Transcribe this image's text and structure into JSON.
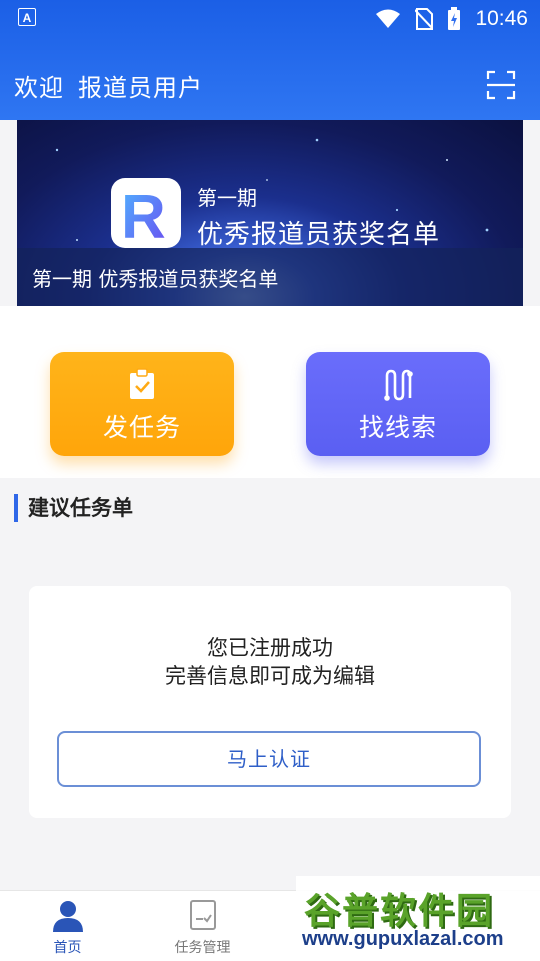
{
  "status_bar": {
    "app_icon_letter": "A",
    "time": "10:46"
  },
  "app_bar": {
    "greeting": "欢迎",
    "user_name": "报道员用户"
  },
  "banner": {
    "logo_letter": "R",
    "issue_label": "第一期",
    "headline": "优秀报道员获奖名单",
    "caption": "第一期 优秀报道员获奖名单"
  },
  "actions": {
    "post_task": "发任务",
    "find_clue": "找线索"
  },
  "section": {
    "title": "建议任务单"
  },
  "notice_card": {
    "line1": "您已注册成功",
    "line2": "完善信息即可成为编辑",
    "button": "马上认证"
  },
  "tab_bar": {
    "tabs": [
      {
        "label": "首页",
        "icon": "home-user-icon",
        "active": true
      },
      {
        "label": "任务管理",
        "icon": "task-list-icon",
        "active": false
      }
    ]
  },
  "watermark": {
    "title": "谷普软件园",
    "url": "www.gupuxlazal.com"
  },
  "colors": {
    "header": "#2f76f2",
    "task_button": "#ffa50a",
    "clue_button": "#5a5ff2",
    "accent": "#2f67e8"
  }
}
